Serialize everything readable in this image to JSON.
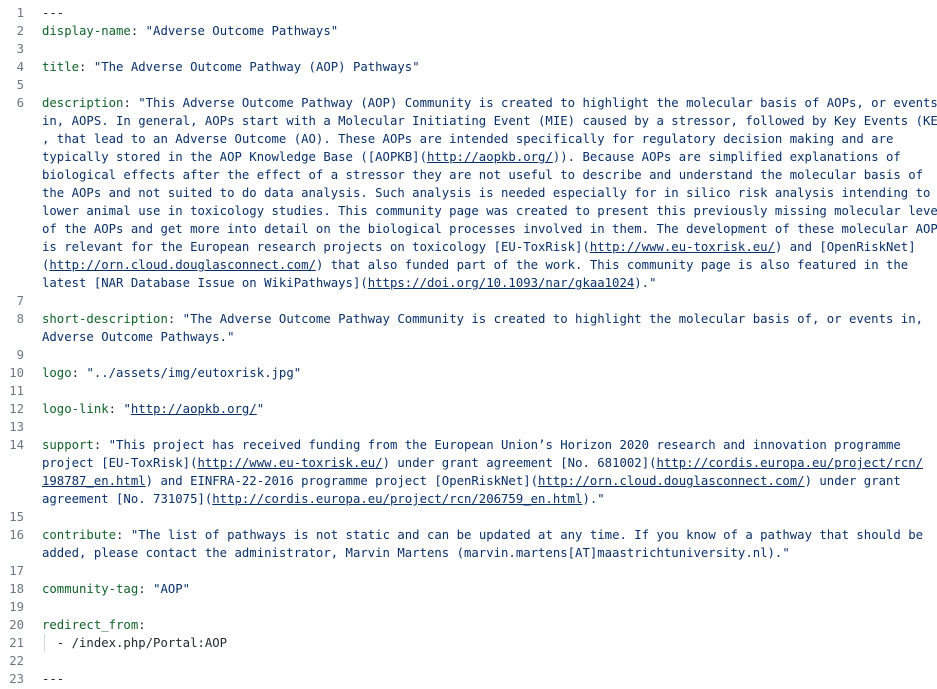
{
  "colors": {
    "key": "#116329",
    "string": "#0a3069",
    "line_number": "#6e7781",
    "text": "#24292f"
  },
  "lines": [
    {
      "num": "1",
      "segments": [
        {
          "t": "---",
          "c": "punct"
        }
      ]
    },
    {
      "num": "2",
      "segments": [
        {
          "t": "display-name",
          "c": "key"
        },
        {
          "t": ": ",
          "c": "punct"
        },
        {
          "t": "\"Adverse Outcome Pathways\"",
          "c": "str"
        }
      ]
    },
    {
      "num": "3",
      "segments": []
    },
    {
      "num": "4",
      "segments": [
        {
          "t": "title",
          "c": "key"
        },
        {
          "t": ": ",
          "c": "punct"
        },
        {
          "t": "\"The Adverse Outcome Pathway (AOP) Pathways\"",
          "c": "str"
        }
      ]
    },
    {
      "num": "5",
      "segments": []
    },
    {
      "num": "6",
      "segments": [
        {
          "t": "description",
          "c": "key"
        },
        {
          "t": ": ",
          "c": "punct"
        },
        {
          "t": "\"This Adverse Outcome Pathway (AOP) Community is created to highlight the molecular basis of AOPs, or events",
          "c": "str"
        }
      ]
    },
    {
      "num": "",
      "segments": [
        {
          "t": "in, AOPS. In general, AOPs start with a Molecular Initiating Event (MIE) caused by a stressor, followed by Key Events (KEs)",
          "c": "str"
        }
      ]
    },
    {
      "num": "",
      "segments": [
        {
          "t": ", that lead to an Adverse Outcome (AO). These AOPs are intended specifically for regulatory decision making and are",
          "c": "str"
        }
      ]
    },
    {
      "num": "",
      "segments": [
        {
          "t": "typically stored in the AOP Knowledge Base ([AOPKB](",
          "c": "str"
        },
        {
          "t": "http://aopkb.org/",
          "c": "str link"
        },
        {
          "t": ")). Because AOPs are simplified explanations of",
          "c": "str"
        }
      ]
    },
    {
      "num": "",
      "segments": [
        {
          "t": "biological effects after the effect of a stressor they are not useful to describe and understand the molecular basis of",
          "c": "str"
        }
      ]
    },
    {
      "num": "",
      "segments": [
        {
          "t": "the AOPs and not suited to do data analysis. Such analysis is needed especially for in silico risk analysis intending to",
          "c": "str"
        }
      ]
    },
    {
      "num": "",
      "segments": [
        {
          "t": "lower animal use in toxicology studies. This community page was created to present this previously missing molecular level",
          "c": "str"
        }
      ]
    },
    {
      "num": "",
      "segments": [
        {
          "t": "of the AOPs and get more into detail on the biological processes involved in them. The development of these molecular AOPS",
          "c": "str"
        }
      ]
    },
    {
      "num": "",
      "segments": [
        {
          "t": "is relevant for the European research projects on toxicology [EU-ToxRisk](",
          "c": "str"
        },
        {
          "t": "http://www.eu-toxrisk.eu/",
          "c": "str link"
        },
        {
          "t": ") and [OpenRiskNet]",
          "c": "str"
        }
      ]
    },
    {
      "num": "",
      "segments": [
        {
          "t": "(",
          "c": "str"
        },
        {
          "t": "http://orn.cloud.douglasconnect.com/",
          "c": "str link"
        },
        {
          "t": ") that also funded part of the work. This community page is also featured in the",
          "c": "str"
        }
      ]
    },
    {
      "num": "",
      "segments": [
        {
          "t": "latest [NAR Database Issue on WikiPathways](",
          "c": "str"
        },
        {
          "t": "https://doi.org/10.1093/nar/gkaa1024",
          "c": "str link"
        },
        {
          "t": ").\"",
          "c": "str"
        }
      ]
    },
    {
      "num": "7",
      "segments": []
    },
    {
      "num": "8",
      "segments": [
        {
          "t": "short-description",
          "c": "key"
        },
        {
          "t": ": ",
          "c": "punct"
        },
        {
          "t": "\"The Adverse Outcome Pathway Community is created to highlight the molecular basis of, or events in,",
          "c": "str"
        }
      ]
    },
    {
      "num": "",
      "segments": [
        {
          "t": "Adverse Outcome Pathways.\"",
          "c": "str"
        }
      ]
    },
    {
      "num": "9",
      "segments": []
    },
    {
      "num": "10",
      "segments": [
        {
          "t": "logo",
          "c": "key"
        },
        {
          "t": ": ",
          "c": "punct"
        },
        {
          "t": "\"../assets/img/eutoxrisk.jpg\"",
          "c": "str"
        }
      ]
    },
    {
      "num": "11",
      "segments": []
    },
    {
      "num": "12",
      "segments": [
        {
          "t": "logo-link",
          "c": "key"
        },
        {
          "t": ": ",
          "c": "punct"
        },
        {
          "t": "\"",
          "c": "str"
        },
        {
          "t": "http://aopkb.org/",
          "c": "str link"
        },
        {
          "t": "\"",
          "c": "str"
        }
      ]
    },
    {
      "num": "13",
      "segments": []
    },
    {
      "num": "14",
      "segments": [
        {
          "t": "support",
          "c": "key"
        },
        {
          "t": ": ",
          "c": "punct"
        },
        {
          "t": "\"This project has received funding from the European Union’s Horizon 2020 research and innovation programme",
          "c": "str"
        }
      ]
    },
    {
      "num": "",
      "segments": [
        {
          "t": "project [EU-ToxRisk](",
          "c": "str"
        },
        {
          "t": "http://www.eu-toxrisk.eu/",
          "c": "str link"
        },
        {
          "t": ") under grant agreement [No. 681002](",
          "c": "str"
        },
        {
          "t": "http://cordis.europa.eu/project/rcn/",
          "c": "str link"
        }
      ]
    },
    {
      "num": "",
      "segments": [
        {
          "t": "198787_en.html",
          "c": "str link"
        },
        {
          "t": ") and EINFRA-22-2016 programme project [OpenRiskNet](",
          "c": "str"
        },
        {
          "t": "http://orn.cloud.douglasconnect.com/",
          "c": "str link"
        },
        {
          "t": ") under grant",
          "c": "str"
        }
      ]
    },
    {
      "num": "",
      "segments": [
        {
          "t": "agreement [No. 731075](",
          "c": "str"
        },
        {
          "t": "http://cordis.europa.eu/project/rcn/206759_en.html",
          "c": "str link"
        },
        {
          "t": ").\"",
          "c": "str"
        }
      ]
    },
    {
      "num": "15",
      "segments": []
    },
    {
      "num": "16",
      "segments": [
        {
          "t": "contribute",
          "c": "key"
        },
        {
          "t": ": ",
          "c": "punct"
        },
        {
          "t": "\"The list of pathways is not static and can be updated at any time. If you know of a pathway that should be",
          "c": "str"
        }
      ]
    },
    {
      "num": "",
      "segments": [
        {
          "t": "added, please contact the administrator, Marvin Martens (marvin.martens[AT]maastrichtuniversity.nl).\"",
          "c": "str"
        }
      ]
    },
    {
      "num": "17",
      "segments": []
    },
    {
      "num": "18",
      "segments": [
        {
          "t": "community-tag",
          "c": "key"
        },
        {
          "t": ": ",
          "c": "punct"
        },
        {
          "t": "\"AOP\"",
          "c": "str"
        }
      ]
    },
    {
      "num": "19",
      "segments": []
    },
    {
      "num": "20",
      "segments": [
        {
          "t": "redirect_from",
          "c": "key"
        },
        {
          "t": ":",
          "c": "punct"
        }
      ]
    },
    {
      "num": "21",
      "segments": [
        {
          "t": "  - /index.php/Portal:AOP",
          "c": "punct"
        }
      ]
    },
    {
      "num": "22",
      "segments": []
    },
    {
      "num": "23",
      "segments": [
        {
          "t": "---",
          "c": "punct"
        }
      ]
    }
  ]
}
